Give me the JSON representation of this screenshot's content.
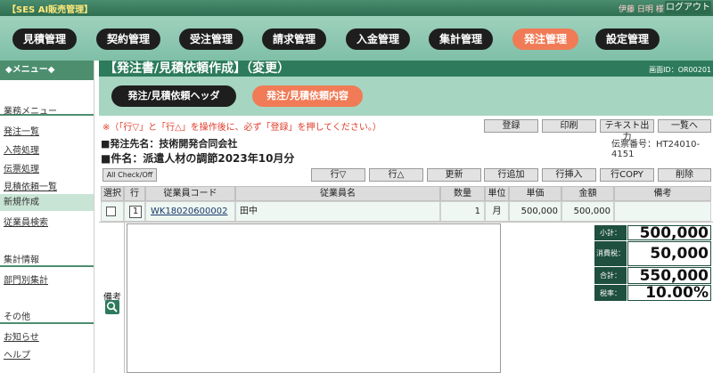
{
  "app": {
    "title": "【SES AI販売管理】",
    "user": "伊藤 日明 様",
    "logout": "ログアウト"
  },
  "nav": {
    "items": [
      {
        "label": "見積管理",
        "active": false
      },
      {
        "label": "契約管理",
        "active": false
      },
      {
        "label": "受注管理",
        "active": false
      },
      {
        "label": "請求管理",
        "active": false
      },
      {
        "label": "入金管理",
        "active": false
      },
      {
        "label": "集計管理",
        "active": false
      },
      {
        "label": "発注管理",
        "active": true
      },
      {
        "label": "設定管理",
        "active": false
      }
    ]
  },
  "sidebar": {
    "menu_header": "◆メニュー◆",
    "sections": [
      {
        "title": "業務メニュー",
        "items": [
          {
            "label": "発注一覧"
          },
          {
            "label": "入荷処理"
          },
          {
            "label": "伝票処理"
          },
          {
            "label": "見積依頼一覧"
          },
          {
            "label": "新規作成",
            "active": true
          },
          {
            "label": "従業員検索"
          }
        ]
      },
      {
        "title": "集計情報",
        "items": [
          {
            "label": "部門別集計"
          }
        ]
      },
      {
        "title": "その他",
        "items": [
          {
            "label": "お知らせ"
          },
          {
            "label": "ヘルプ"
          }
        ]
      }
    ]
  },
  "page": {
    "title": "【発注書/見積依頼作成】（変更）",
    "screen_id": "画面ID：OR00201"
  },
  "subtabs": [
    {
      "label": "発注/見積依頼ヘッダ",
      "active": false
    },
    {
      "label": "発注/見積依頼内容",
      "active": true
    }
  ],
  "notice": "※（「行▽」と「行△」を操作後に、必ず「登録」を押してください。）",
  "top_buttons": {
    "register": "登録",
    "print": "印刷",
    "text_export": "テキスト出力",
    "back_to_list": "一覧へ"
  },
  "slip_number": "伝票番号：HT24010-4151",
  "destination": "■発注先名：技術開発合同会社",
  "subject": "■件名：派遣人材の調節2023年10月分",
  "row_buttons": {
    "check_all": "All Check/Off",
    "row_down": "行▽",
    "row_up": "行△",
    "update": "更新",
    "add_row": "行追加",
    "insert_row": "行挿入",
    "copy_row": "行COPY",
    "delete": "削除"
  },
  "table": {
    "columns": [
      "選択",
      "行",
      "従業員コード",
      "従業員名",
      "数量",
      "単位",
      "単価",
      "金額",
      "備考"
    ],
    "rows": [
      {
        "selected": false,
        "line": "1",
        "code": "WK18020600002",
        "name": "田中",
        "qty": "1",
        "unit": "月",
        "unit_price": "500,000",
        "amount": "500,000",
        "remarks": ""
      }
    ]
  },
  "remarks_label": "備考",
  "totals": {
    "subtotal_label": "小計：",
    "subtotal": "500,000",
    "tax_label": "消費税：",
    "tax": "50,000",
    "total_label": "合計：",
    "total": "550,000",
    "tax_rate_label": "税率：",
    "tax_rate": "10.00%"
  },
  "colors": {
    "nav_active": "#f07b56",
    "header_green": "#2d7b5c",
    "notice_red": "#e03b2a"
  }
}
